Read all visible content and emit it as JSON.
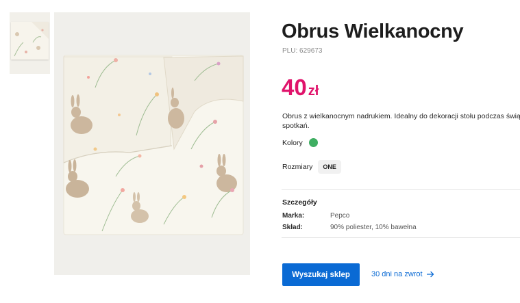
{
  "product": {
    "title": "Obrus Wielkanocny",
    "plu": "PLU: 629673",
    "price_amount": "40",
    "price_currency": "zł",
    "description_line1": "Obrus z wielkanocnym nadrukiem. Idealny do dekoracji stołu podczas świątec",
    "description_line2": "spotkań."
  },
  "options": {
    "colors_label": "Kolory",
    "color_swatch": "#3fae62",
    "sizes_label": "Rozmiary",
    "size_value": "ONE"
  },
  "details": {
    "title": "Szczegóły",
    "rows": [
      {
        "key": "Marka:",
        "value": "Pepco"
      },
      {
        "key": "Skład:",
        "value": "90% poliester, 10% bawełna"
      }
    ]
  },
  "actions": {
    "find_store": "Wyszukaj sklep",
    "return_link": "30 dni na zwrot"
  },
  "icons": {
    "return_arrow": "arrow-right-icon"
  },
  "colors": {
    "price": "#e0136b",
    "button": "#0a6ad4",
    "link": "#0a6ad4"
  }
}
